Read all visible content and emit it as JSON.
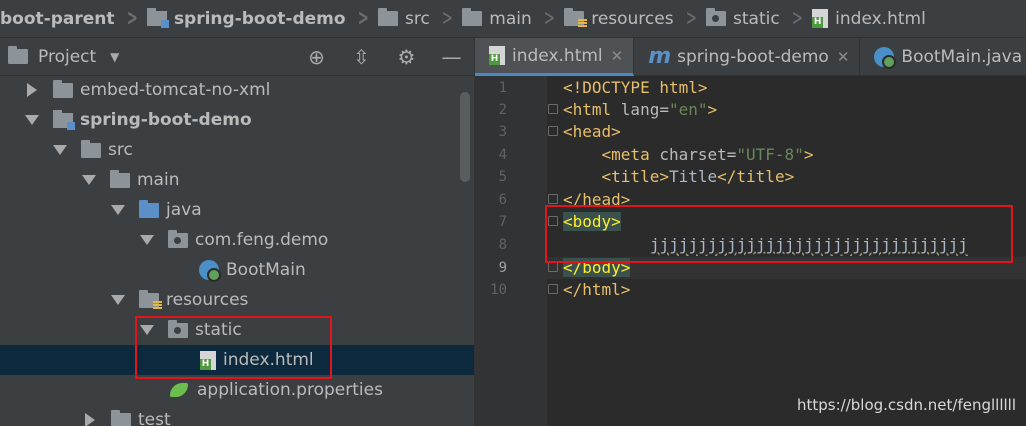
{
  "breadcrumbs": [
    {
      "label": "boot-parent",
      "icon": "none",
      "bold": true
    },
    {
      "label": "spring-boot-demo",
      "icon": "module-folder-icon",
      "bold": true
    },
    {
      "label": "src",
      "icon": "folder-icon",
      "bold": false
    },
    {
      "label": "main",
      "icon": "folder-icon",
      "bold": false
    },
    {
      "label": "resources",
      "icon": "resources-folder-icon",
      "bold": false
    },
    {
      "label": "static",
      "icon": "package-folder-icon",
      "bold": false
    },
    {
      "label": "index.html",
      "icon": "html-file-icon",
      "bold": false
    }
  ],
  "project_panel": {
    "title": "Project",
    "tools": [
      "target-icon",
      "collapse-icon",
      "gear-icon",
      "minimize-icon"
    ]
  },
  "tree": [
    {
      "label": "embed-tomcat-no-xml",
      "arrow": "right",
      "icon": "folder",
      "bold": false
    },
    {
      "label": "spring-boot-demo",
      "arrow": "down",
      "icon": "module",
      "bold": true
    },
    {
      "label": "src",
      "arrow": "down",
      "icon": "folder",
      "bold": false
    },
    {
      "label": "main",
      "arrow": "down",
      "icon": "folder",
      "bold": false
    },
    {
      "label": "java",
      "arrow": "down",
      "icon": "blue-folder",
      "bold": false
    },
    {
      "label": "com.feng.demo",
      "arrow": "down",
      "icon": "package",
      "bold": false
    },
    {
      "label": "BootMain",
      "arrow": "none",
      "icon": "boot",
      "bold": false
    },
    {
      "label": "resources",
      "arrow": "down",
      "icon": "resources",
      "bold": false
    },
    {
      "label": "static",
      "arrow": "down",
      "icon": "package",
      "bold": false
    },
    {
      "label": "index.html",
      "arrow": "none",
      "icon": "html",
      "bold": false,
      "selected": true
    },
    {
      "label": "application.properties",
      "arrow": "none",
      "icon": "spring",
      "bold": false
    },
    {
      "label": "test",
      "arrow": "right",
      "icon": "folder",
      "bold": false
    }
  ],
  "tabs": [
    {
      "label": "index.html",
      "icon": "html-file-icon",
      "active": true,
      "closable": true
    },
    {
      "label": "spring-boot-demo",
      "icon": "maven-icon",
      "active": false,
      "closable": true
    },
    {
      "label": "BootMain.java",
      "icon": "boot-class-icon",
      "active": false,
      "closable": false
    }
  ],
  "editor": {
    "line_numbers": [
      "1",
      "2",
      "3",
      "4",
      "5",
      "6",
      "7",
      "8",
      "9",
      "10"
    ],
    "current_line": "9",
    "lines": {
      "l1": "<!DOCTYPE html>",
      "l2_open": "<html ",
      "l2_attr": "lang=",
      "l2_val": "\"en\"",
      "l2_close": ">",
      "l3": "<head>",
      "l4_open": "    <meta ",
      "l4_attr": "charset=",
      "l4_val": "\"UTF-8\"",
      "l4_close": ">",
      "l5_open": "    <title>",
      "l5_text": "Title",
      "l5_close": "</title>",
      "l6": "</head>",
      "l7": "<body>",
      "l8": "jjjjjjjjjjjjjjjjjjjjjjjjjjjjjjjjj",
      "l9": "</body>",
      "l10": "</html>"
    }
  },
  "watermark": "https://blog.csdn.net/fengllllll"
}
